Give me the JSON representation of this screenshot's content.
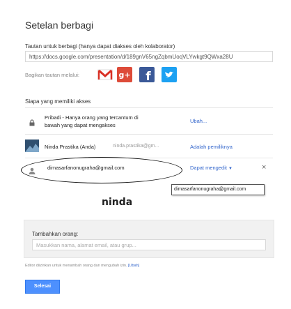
{
  "dialog": {
    "title": "Setelan berbagi",
    "link_section_label": "Tautan untuk berbagi (hanya dapat diakses oleh kolaborator)",
    "share_url": "https://docs.google.com/presentation/d/189gnV65ngZqbmUoqVLYwkgt9QWxa28U",
    "share_via_label": "Bagikan tautan melalui:",
    "share_icons": [
      "gmail-icon",
      "google-plus-icon",
      "facebook-icon",
      "twitter-icon"
    ],
    "access_section_label": "Siapa yang memiliki akses",
    "access_rows": [
      {
        "icon": "lock-icon",
        "text": "Pribadi - Hanya orang yang tercantum di bawah yang dapat mengakses",
        "action": "Ubah..."
      },
      {
        "icon": "avatar",
        "name": "Ninda Prastika (Anda)",
        "email": "ninda.prastika@gm...",
        "role": "Adalah pemiliknya"
      },
      {
        "icon": "person-icon",
        "email": "dimasarfanonugraha@gmail.com",
        "permission": "Dapat mengedit",
        "remove": "×"
      }
    ],
    "tooltip_email": "dimasarfanonugraha@gmail.com",
    "annotation_text": "ninda",
    "add_people_label": "Tambahkan orang:",
    "add_people_placeholder": "Masukkan nama, alamat email, atau grup...",
    "footnote_text": "Editor diizinkan untuk menambah orang dan mengubah izin.",
    "footnote_link": "[Ubah]",
    "done_button": "Selesai",
    "colors": {
      "link": "#3366cc",
      "primary_button": "#4d90fe",
      "google_plus": "#dd4b39",
      "facebook": "#3b5998",
      "twitter": "#1da1f2"
    }
  }
}
